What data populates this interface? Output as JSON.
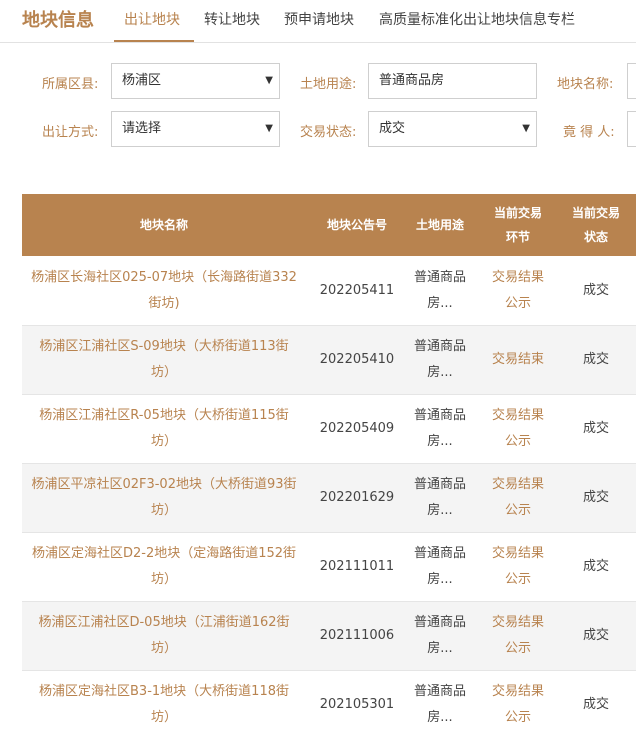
{
  "header": {
    "brand": "地块信息",
    "tabs": [
      "出让地块",
      "转让地块",
      "预申请地块",
      "高质量标准化出让地块信息专栏"
    ]
  },
  "filters": {
    "district_label": "所属区县:",
    "district_value": "杨浦区",
    "land_use_label": "土地用途:",
    "land_use_value": "普通商品房",
    "land_name_label": "地块名称:",
    "method_label": "出让方式:",
    "method_value": "请选择",
    "status_label": "交易状态:",
    "status_value": "成交",
    "bidder_label": "竟 得 人:"
  },
  "table": {
    "headers": {
      "name": "地块名称",
      "notice_no": "地块公告号",
      "land_use": "土地用途",
      "stage_line1": "当前交易",
      "stage_line2": "环节",
      "status_line1": "当前交易",
      "status_line2": "状态"
    },
    "rows": [
      {
        "name_1": "杨浦区长海社区025-07地块（长海路街道332",
        "name_2": "街坊)",
        "notice_no": "202205411",
        "use_1": "普通商品",
        "use_2": "房...",
        "stage_1": "交易结果",
        "stage_2": "公示",
        "status": "成交"
      },
      {
        "name_1": "杨浦区江浦社区S-09地块（大桥街道113街",
        "name_2": "坊）",
        "notice_no": "202205410",
        "use_1": "普通商品",
        "use_2": "房...",
        "stage_1": "交易结束",
        "stage_2": "",
        "status": "成交"
      },
      {
        "name_1": "杨浦区江浦社区R-05地块（大桥街道115街",
        "name_2": "坊）",
        "notice_no": "202205409",
        "use_1": "普通商品",
        "use_2": "房...",
        "stage_1": "交易结果",
        "stage_2": "公示",
        "status": "成交"
      },
      {
        "name_1": "杨浦区平凉社区02F3-02地块（大桥街道93街",
        "name_2": "坊）",
        "notice_no": "202201629",
        "use_1": "普通商品",
        "use_2": "房...",
        "stage_1": "交易结果",
        "stage_2": "公示",
        "status": "成交"
      },
      {
        "name_1": "杨浦区定海社区D2-2地块（定海路街道152街",
        "name_2": "坊）",
        "notice_no": "202111011",
        "use_1": "普通商品",
        "use_2": "房...",
        "stage_1": "交易结果",
        "stage_2": "公示",
        "status": "成交"
      },
      {
        "name_1": "杨浦区江浦社区D-05地块（江浦街道162街",
        "name_2": "坊）",
        "notice_no": "202111006",
        "use_1": "普通商品",
        "use_2": "房...",
        "stage_1": "交易结果",
        "stage_2": "公示",
        "status": "成交"
      },
      {
        "name_1": "杨浦区定海社区B3-1地块（大桥街道118街",
        "name_2": "坊）",
        "notice_no": "202105301",
        "use_1": "普通商品",
        "use_2": "房...",
        "stage_1": "交易结果",
        "stage_2": "公示",
        "status": "成交"
      }
    ]
  }
}
